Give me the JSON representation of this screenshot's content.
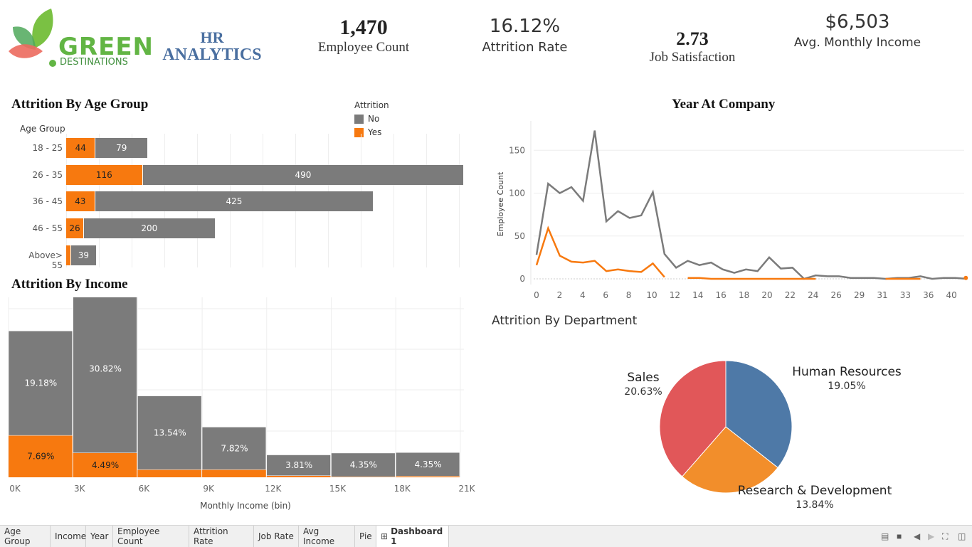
{
  "brand": {
    "logo_word": "GREEN",
    "logo_sub": "DESTINATIONS",
    "title_line1": "HR",
    "title_line2": "ANALYTICS"
  },
  "kpis": {
    "employee_count": {
      "value": "1,470",
      "label": "Employee Count"
    },
    "attrition_rate": {
      "value": "16.12%",
      "label": "Attrition Rate"
    },
    "job_satisfaction": {
      "value": "2.73",
      "label": "Job Satisfaction"
    },
    "avg_income": {
      "value": "$6,503",
      "label": "Avg. Monthly Income"
    }
  },
  "colors": {
    "yes": "#f7790f",
    "no": "#7b7b7b",
    "hr": "#4e79a7",
    "rd": "#f28e2b",
    "sales": "#e15759"
  },
  "age_chart": {
    "title": "Attrition By Age Group",
    "axis_label": "Age Group",
    "legend_title": "Attrition",
    "legend": [
      "No",
      "Yes"
    ],
    "rows": [
      {
        "label": "18 - 25",
        "yes": 44,
        "no": 79
      },
      {
        "label": "26 - 35",
        "yes": 116,
        "no": 490
      },
      {
        "label": "36 - 45",
        "yes": 43,
        "no": 425
      },
      {
        "label": "46 - 55",
        "yes": 26,
        "no": 200
      },
      {
        "label": "Above> 55",
        "yes": 6,
        "no": 39
      }
    ]
  },
  "income_chart": {
    "title": "Attrition By Income",
    "xlabel": "Monthly Income (bin)",
    "ticks": [
      "0K",
      "3K",
      "6K",
      "9K",
      "12K",
      "15K",
      "18K",
      "21K"
    ]
  },
  "years_chart": {
    "title": "Year At Company",
    "ylabel": "Employee Count",
    "yticks": [
      "0",
      "50",
      "100",
      "150"
    ],
    "xticks": [
      "0",
      "2",
      "4",
      "6",
      "8",
      "10",
      "12",
      "14",
      "16",
      "18",
      "20",
      "22",
      "24",
      "26",
      "29",
      "31",
      "33",
      "36",
      "40"
    ]
  },
  "dept_chart": {
    "title": "Attrition By Department",
    "labels": {
      "hr": {
        "name": "Human Resources",
        "pct": "19.05%"
      },
      "rd": {
        "name": "Research & Development",
        "pct": "13.84%"
      },
      "sales": {
        "name": "Sales",
        "pct": "20.63%"
      }
    }
  },
  "chart_data": [
    {
      "type": "bar",
      "title": "Attrition By Age Group",
      "categories": [
        "18 - 25",
        "26 - 35",
        "36 - 45",
        "46 - 55",
        "Above> 55"
      ],
      "series": [
        {
          "name": "Yes",
          "values": [
            44,
            116,
            43,
            26,
            6
          ]
        },
        {
          "name": "No",
          "values": [
            79,
            490,
            425,
            200,
            39
          ]
        }
      ],
      "ylabel": "Age Group"
    },
    {
      "type": "bar",
      "title": "Attrition By Income",
      "xlabel": "Monthly Income (bin)",
      "categories": [
        "0K",
        "3K",
        "6K",
        "9K",
        "12K",
        "15K",
        "18K"
      ],
      "series": [
        {
          "name": "No",
          "values": [
            19.18,
            30.82,
            13.54,
            7.82,
            3.81,
            4.35,
            4.35
          ],
          "labels": [
            "19.18%",
            "30.82%",
            "13.54%",
            "7.82%",
            "3.81%",
            "4.35%",
            "4.35%"
          ]
        },
        {
          "name": "Yes",
          "values": [
            7.69,
            4.49,
            1.4,
            1.4,
            0.3,
            0.1,
            0.2
          ],
          "labels": [
            "7.69%",
            "4.49%",
            "",
            "",
            "",
            "",
            ""
          ]
        }
      ]
    },
    {
      "type": "line",
      "title": "Year At Company",
      "ylabel": "Employee Count",
      "ylim": [
        0,
        180
      ],
      "series": [
        {
          "name": "No",
          "x": [
            0,
            1,
            2,
            3,
            4,
            5,
            6,
            7,
            8,
            9,
            10,
            11,
            12,
            13,
            14,
            15,
            16,
            17,
            18,
            19,
            20,
            21,
            22,
            23,
            24,
            25,
            26,
            27,
            28,
            29,
            30,
            31,
            32,
            33,
            34,
            35,
            36,
            37
          ],
          "y": [
            28,
            111,
            100,
            107,
            91,
            173,
            67,
            79,
            71,
            74,
            101,
            29,
            13,
            21,
            16,
            19,
            11,
            7,
            11,
            9,
            25,
            12,
            13,
            0,
            4,
            3,
            3,
            1,
            1,
            1,
            0,
            1,
            1,
            3,
            0,
            1,
            1,
            0
          ]
        },
        {
          "name": "Yes",
          "x": [
            0,
            1,
            2,
            3,
            4,
            5,
            6,
            7,
            8,
            9,
            10,
            11,
            13,
            14,
            15,
            16,
            17,
            18,
            19,
            20,
            21,
            22,
            23,
            24,
            30,
            31,
            32,
            33,
            40
          ],
          "y": [
            16,
            59,
            27,
            20,
            19,
            21,
            9,
            11,
            9,
            8,
            18,
            2,
            1,
            1,
            0,
            0,
            0,
            0,
            0,
            0,
            0,
            0,
            0,
            0,
            0,
            0,
            0,
            0,
            1
          ]
        }
      ]
    },
    {
      "type": "pie",
      "title": "Attrition By Department",
      "categories": [
        "Human Resources",
        "Research & Development",
        "Sales"
      ],
      "values": [
        19.05,
        13.84,
        20.63
      ]
    }
  ],
  "tabs": [
    "Age Group",
    "Income",
    "Year",
    "Employee Count",
    "Attrition Rate",
    "Job Rate",
    "Avg Income",
    "Pie",
    "Dashboard 1"
  ],
  "active_tab": "Dashboard 1"
}
